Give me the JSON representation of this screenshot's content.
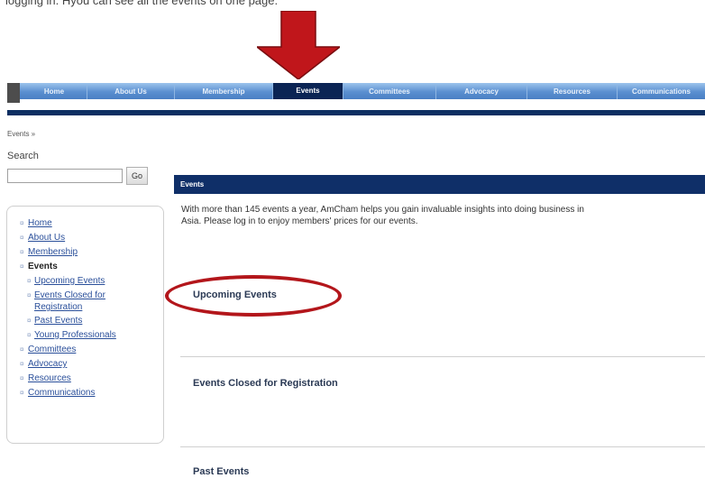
{
  "caption": "logging in. Hyou can see all the events on one page.",
  "nav": {
    "items": [
      "Home",
      "About Us",
      "Membership",
      "Events",
      "Committees",
      "Advocacy",
      "Resources",
      "Communications"
    ],
    "active": "Events"
  },
  "breadcrumb": "Events »",
  "search": {
    "label": "Search",
    "value": "",
    "button": "Go"
  },
  "sidebar": {
    "items": [
      {
        "label": "Home"
      },
      {
        "label": "About Us"
      },
      {
        "label": "Membership"
      },
      {
        "label": "Events"
      },
      {
        "label": "Upcoming Events"
      },
      {
        "label": "Events Closed for"
      },
      {
        "label": "Registration"
      },
      {
        "label": "Past Events"
      },
      {
        "label": "Young Professionals"
      },
      {
        "label": "Committees"
      },
      {
        "label": "Advocacy"
      },
      {
        "label": "Resources"
      },
      {
        "label": "Communications"
      }
    ]
  },
  "main": {
    "header": "Events",
    "intro_line1": "With more than 145 events a year, AmCham helps you gain invaluable insights into doing business in",
    "intro_line2": "Asia. Please log in to enjoy members' prices for our events.",
    "sections": [
      "Upcoming Events",
      "Events Closed for Registration",
      "Past Events"
    ]
  },
  "colors": {
    "arrow": "#c0161b",
    "circle": "#b3161b",
    "nav_active": "#0b2454",
    "header": "#0f2f68"
  }
}
